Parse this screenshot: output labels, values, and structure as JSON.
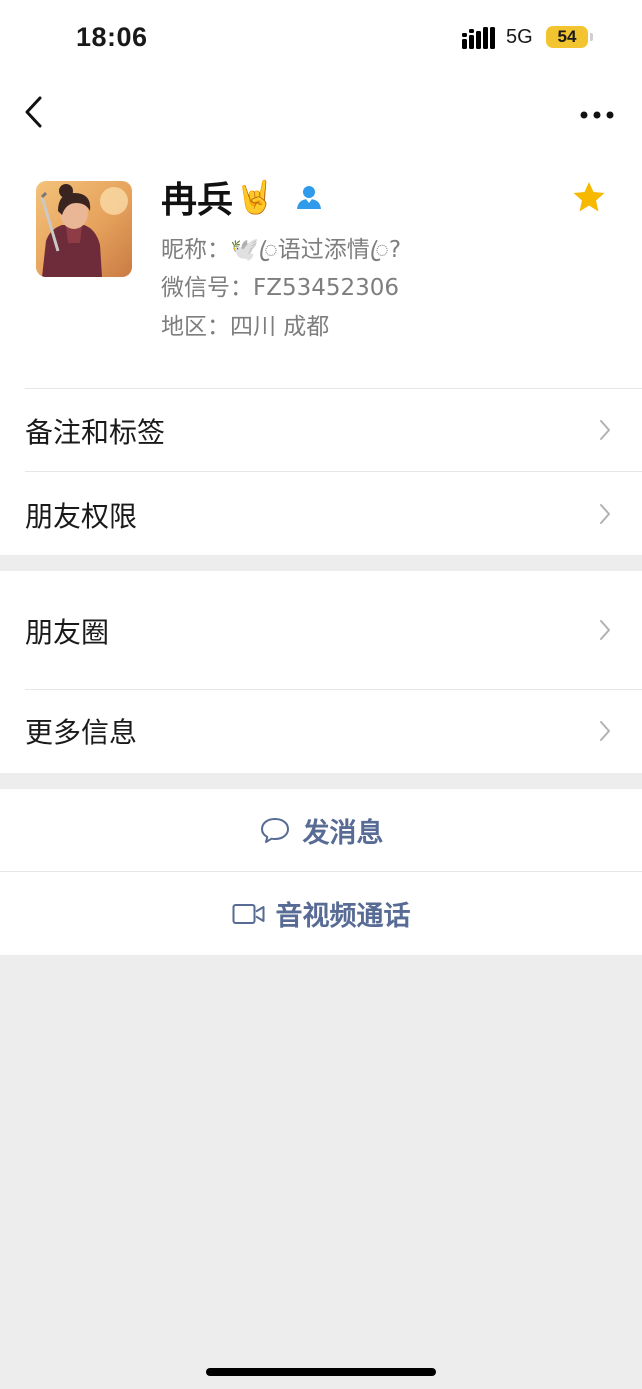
{
  "status_bar": {
    "time": "18:06",
    "network": "5G",
    "battery": "54",
    "battery_color": "#f2c530"
  },
  "nav": {
    "back_icon": "chevron-left-icon",
    "more_icon": "more-dots-icon"
  },
  "profile": {
    "avatar_icon": "avatar-illustration",
    "name": "冉兵",
    "name_emoji": "🤘",
    "contact_icon": "person-contact-icon",
    "star_icon": "star-icon",
    "star_color": "#f7b800",
    "nickname": "昵称：🕊️ꦿ语过添情ꦿ?",
    "wechat_id": "微信号：FZ53452306",
    "region": "地区：四川 成都"
  },
  "menu_group_1": [
    {
      "label": "备注和标签"
    },
    {
      "label": "朋友权限"
    }
  ],
  "menu_group_2": [
    {
      "label": "朋友圈"
    },
    {
      "label": "更多信息"
    }
  ],
  "actions": {
    "message_icon": "chat-bubble-icon",
    "message_label": "发消息",
    "call_icon": "video-camera-icon",
    "call_label": "音视频通话",
    "link_color": "#576b95"
  }
}
